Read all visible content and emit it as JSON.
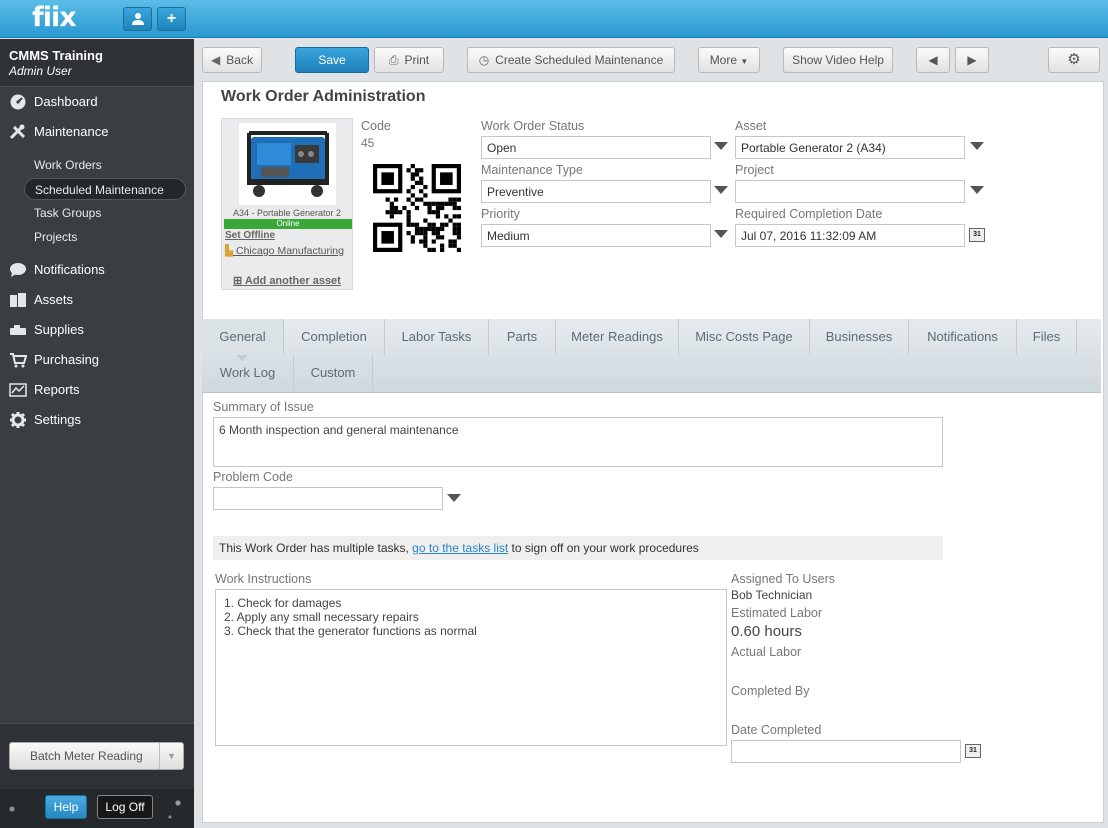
{
  "app": {
    "logo": "fiix"
  },
  "topbar": {
    "user_icon": "user-icon",
    "add_icon": "plus-icon"
  },
  "sidebar": {
    "org_name": "CMMS Training",
    "user_role": "Admin User",
    "items": [
      {
        "label": "Dashboard",
        "icon": "dashboard-icon"
      },
      {
        "label": "Maintenance",
        "icon": "tools-icon"
      },
      {
        "label": "Notifications",
        "icon": "speech-bubble-icon"
      },
      {
        "label": "Assets",
        "icon": "boxes-icon"
      },
      {
        "label": "Supplies",
        "icon": "supplies-icon"
      },
      {
        "label": "Purchasing",
        "icon": "cart-icon"
      },
      {
        "label": "Reports",
        "icon": "chart-icon"
      },
      {
        "label": "Settings",
        "icon": "gear-icon"
      }
    ],
    "maintenance_sub": [
      {
        "label": "Work Orders"
      },
      {
        "label": "Scheduled Maintenance",
        "active": true
      },
      {
        "label": "Task Groups"
      },
      {
        "label": "Projects"
      }
    ],
    "batch_button": "Batch Meter Reading",
    "help_button": "Help",
    "logoff_button": "Log Off"
  },
  "toolbar": {
    "back": "Back",
    "save": "Save",
    "print": "Print",
    "create_sm": "Create Scheduled Maintenance",
    "more": "More",
    "video_help": "Show Video Help"
  },
  "work_order": {
    "page_title": "Work Order Administration",
    "asset_card": {
      "name": "A34 - Portable Generator 2",
      "status": "Online",
      "set_offline": "Set Offline",
      "location": "Chicago Manufacturing",
      "add_asset": "Add another asset"
    },
    "code_label": "Code",
    "code_value": "45",
    "status_label": "Work Order Status",
    "status_value": "Open",
    "maint_type_label": "Maintenance Type",
    "maint_type_value": "Preventive",
    "priority_label": "Priority",
    "priority_value": "Medium",
    "asset_label": "Asset",
    "asset_value": "Portable Generator 2 (A34)",
    "project_label": "Project",
    "project_value": "",
    "req_date_label": "Required Completion Date",
    "req_date_value": "Jul 07, 2016 11:32:09 AM",
    "calendar_text": "31"
  },
  "tabs": [
    {
      "label": "General",
      "active": true
    },
    {
      "label": "Completion"
    },
    {
      "label": "Labor Tasks"
    },
    {
      "label": "Parts"
    },
    {
      "label": "Meter Readings"
    },
    {
      "label": "Misc Costs Page"
    },
    {
      "label": "Businesses"
    },
    {
      "label": "Notifications"
    },
    {
      "label": "Files"
    },
    {
      "label": "Work Log"
    },
    {
      "label": "Custom"
    }
  ],
  "general": {
    "summary_label": "Summary of Issue",
    "summary_value": "6 Month inspection and general maintenance",
    "problem_code_label": "Problem Code",
    "problem_code_value": "",
    "task_notice_pre": "This Work Order has multiple tasks, ",
    "task_notice_link": "go to the tasks list",
    "task_notice_post": " to sign off on your work procedures",
    "instructions_label": "Work Instructions",
    "instructions": [
      "1.  Check for damages",
      "2.  Apply any small necessary repairs",
      "3.  Check that the generator functions as normal"
    ],
    "assigned_label": "Assigned To Users",
    "assigned_value": "Bob Technician",
    "est_labor_label": "Estimated Labor",
    "est_labor_value": "0.60 hours",
    "actual_labor_label": "Actual Labor",
    "completed_by_label": "Completed By",
    "date_completed_label": "Date Completed",
    "date_completed_value": ""
  }
}
